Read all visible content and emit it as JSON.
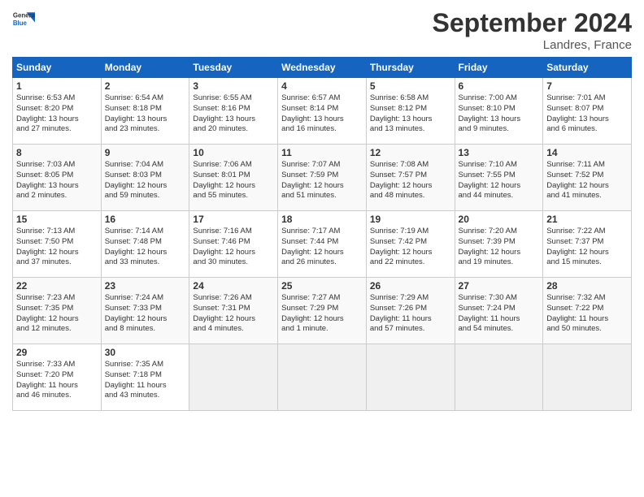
{
  "logo": {
    "line1": "General",
    "line2": "Blue"
  },
  "title": "September 2024",
  "location": "Landres, France",
  "days_of_week": [
    "Sunday",
    "Monday",
    "Tuesday",
    "Wednesday",
    "Thursday",
    "Friday",
    "Saturday"
  ],
  "weeks": [
    [
      {
        "day": "1",
        "info": "Sunrise: 6:53 AM\nSunset: 8:20 PM\nDaylight: 13 hours\nand 27 minutes."
      },
      {
        "day": "2",
        "info": "Sunrise: 6:54 AM\nSunset: 8:18 PM\nDaylight: 13 hours\nand 23 minutes."
      },
      {
        "day": "3",
        "info": "Sunrise: 6:55 AM\nSunset: 8:16 PM\nDaylight: 13 hours\nand 20 minutes."
      },
      {
        "day": "4",
        "info": "Sunrise: 6:57 AM\nSunset: 8:14 PM\nDaylight: 13 hours\nand 16 minutes."
      },
      {
        "day": "5",
        "info": "Sunrise: 6:58 AM\nSunset: 8:12 PM\nDaylight: 13 hours\nand 13 minutes."
      },
      {
        "day": "6",
        "info": "Sunrise: 7:00 AM\nSunset: 8:10 PM\nDaylight: 13 hours\nand 9 minutes."
      },
      {
        "day": "7",
        "info": "Sunrise: 7:01 AM\nSunset: 8:07 PM\nDaylight: 13 hours\nand 6 minutes."
      }
    ],
    [
      {
        "day": "8",
        "info": "Sunrise: 7:03 AM\nSunset: 8:05 PM\nDaylight: 13 hours\nand 2 minutes."
      },
      {
        "day": "9",
        "info": "Sunrise: 7:04 AM\nSunset: 8:03 PM\nDaylight: 12 hours\nand 59 minutes."
      },
      {
        "day": "10",
        "info": "Sunrise: 7:06 AM\nSunset: 8:01 PM\nDaylight: 12 hours\nand 55 minutes."
      },
      {
        "day": "11",
        "info": "Sunrise: 7:07 AM\nSunset: 7:59 PM\nDaylight: 12 hours\nand 51 minutes."
      },
      {
        "day": "12",
        "info": "Sunrise: 7:08 AM\nSunset: 7:57 PM\nDaylight: 12 hours\nand 48 minutes."
      },
      {
        "day": "13",
        "info": "Sunrise: 7:10 AM\nSunset: 7:55 PM\nDaylight: 12 hours\nand 44 minutes."
      },
      {
        "day": "14",
        "info": "Sunrise: 7:11 AM\nSunset: 7:52 PM\nDaylight: 12 hours\nand 41 minutes."
      }
    ],
    [
      {
        "day": "15",
        "info": "Sunrise: 7:13 AM\nSunset: 7:50 PM\nDaylight: 12 hours\nand 37 minutes."
      },
      {
        "day": "16",
        "info": "Sunrise: 7:14 AM\nSunset: 7:48 PM\nDaylight: 12 hours\nand 33 minutes."
      },
      {
        "day": "17",
        "info": "Sunrise: 7:16 AM\nSunset: 7:46 PM\nDaylight: 12 hours\nand 30 minutes."
      },
      {
        "day": "18",
        "info": "Sunrise: 7:17 AM\nSunset: 7:44 PM\nDaylight: 12 hours\nand 26 minutes."
      },
      {
        "day": "19",
        "info": "Sunrise: 7:19 AM\nSunset: 7:42 PM\nDaylight: 12 hours\nand 22 minutes."
      },
      {
        "day": "20",
        "info": "Sunrise: 7:20 AM\nSunset: 7:39 PM\nDaylight: 12 hours\nand 19 minutes."
      },
      {
        "day": "21",
        "info": "Sunrise: 7:22 AM\nSunset: 7:37 PM\nDaylight: 12 hours\nand 15 minutes."
      }
    ],
    [
      {
        "day": "22",
        "info": "Sunrise: 7:23 AM\nSunset: 7:35 PM\nDaylight: 12 hours\nand 12 minutes."
      },
      {
        "day": "23",
        "info": "Sunrise: 7:24 AM\nSunset: 7:33 PM\nDaylight: 12 hours\nand 8 minutes."
      },
      {
        "day": "24",
        "info": "Sunrise: 7:26 AM\nSunset: 7:31 PM\nDaylight: 12 hours\nand 4 minutes."
      },
      {
        "day": "25",
        "info": "Sunrise: 7:27 AM\nSunset: 7:29 PM\nDaylight: 12 hours\nand 1 minute."
      },
      {
        "day": "26",
        "info": "Sunrise: 7:29 AM\nSunset: 7:26 PM\nDaylight: 11 hours\nand 57 minutes."
      },
      {
        "day": "27",
        "info": "Sunrise: 7:30 AM\nSunset: 7:24 PM\nDaylight: 11 hours\nand 54 minutes."
      },
      {
        "day": "28",
        "info": "Sunrise: 7:32 AM\nSunset: 7:22 PM\nDaylight: 11 hours\nand 50 minutes."
      }
    ],
    [
      {
        "day": "29",
        "info": "Sunrise: 7:33 AM\nSunset: 7:20 PM\nDaylight: 11 hours\nand 46 minutes."
      },
      {
        "day": "30",
        "info": "Sunrise: 7:35 AM\nSunset: 7:18 PM\nDaylight: 11 hours\nand 43 minutes."
      },
      {
        "day": "",
        "info": ""
      },
      {
        "day": "",
        "info": ""
      },
      {
        "day": "",
        "info": ""
      },
      {
        "day": "",
        "info": ""
      },
      {
        "day": "",
        "info": ""
      }
    ]
  ]
}
